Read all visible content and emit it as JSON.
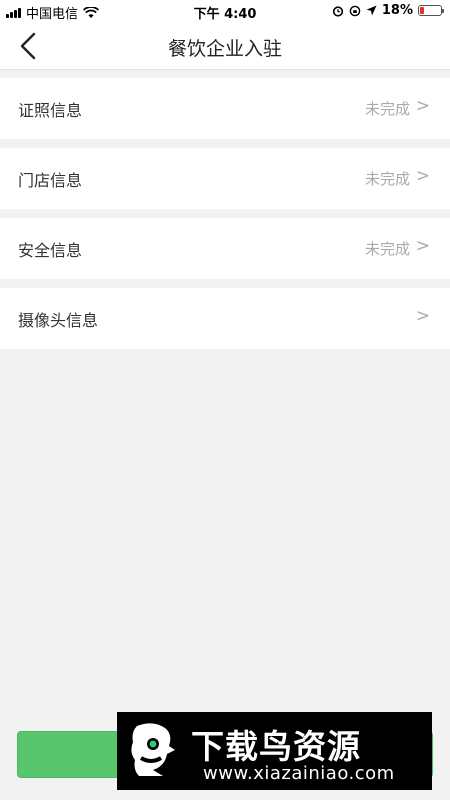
{
  "status_bar": {
    "carrier": "中国电信",
    "time": "下午 4:40",
    "battery_percent": "18%",
    "battery_level": 0.18,
    "icons": [
      "signal-icon",
      "wifi-icon",
      "alarm-icon",
      "rotation-lock-icon",
      "location-icon",
      "battery-icon"
    ]
  },
  "navbar": {
    "title": "餐饮企业入驻",
    "back_icon": "chevron-left-icon"
  },
  "list": {
    "items": [
      {
        "label": "证照信息",
        "status": "未完成",
        "chevron": ">"
      },
      {
        "label": "门店信息",
        "status": "未完成",
        "chevron": ">"
      },
      {
        "label": "安全信息",
        "status": "未完成",
        "chevron": ">"
      },
      {
        "label": "摄像头信息",
        "status": "",
        "chevron": ">"
      }
    ]
  },
  "submit_button": {
    "label": "",
    "color": "#57c66c"
  },
  "watermark": {
    "title": "下载鸟资源",
    "url": "www.xiazainiao.com"
  },
  "colors": {
    "background": "#f2f2f2",
    "card": "#ffffff",
    "muted_text": "#aaaaaa",
    "primary_green": "#57c66c",
    "battery_low": "#e0322e"
  }
}
